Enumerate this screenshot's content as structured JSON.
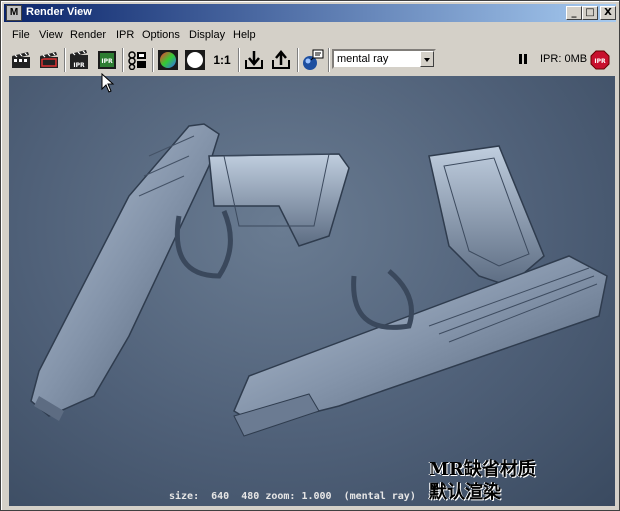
{
  "window": {
    "title": "Render View",
    "app_icon": "M"
  },
  "title_buttons": {
    "minimize": "_",
    "maximize": "□",
    "close": "X"
  },
  "menu": [
    "File",
    "View",
    "Render",
    "IPR",
    "Options",
    "Display",
    "Help"
  ],
  "toolbar": {
    "aspect_label": "1:1",
    "renderer": "mental ray",
    "ipr_status": "IPR: 0MB",
    "ipr_badge": "IPR",
    "ipr_icon_text": "IPR"
  },
  "viewport": {
    "status_line": "size:  640  480 zoom: 1.000  (mental ray)",
    "caption_line1": "MR缺省材质",
    "caption_line2": "默认渲染"
  },
  "colors": {
    "titlebar_start": "#0a246a",
    "titlebar_end": "#a6caf0",
    "chrome": "#d4d0c8",
    "viewport_bg": "#4f6078",
    "stop_red": "#c8102e"
  }
}
